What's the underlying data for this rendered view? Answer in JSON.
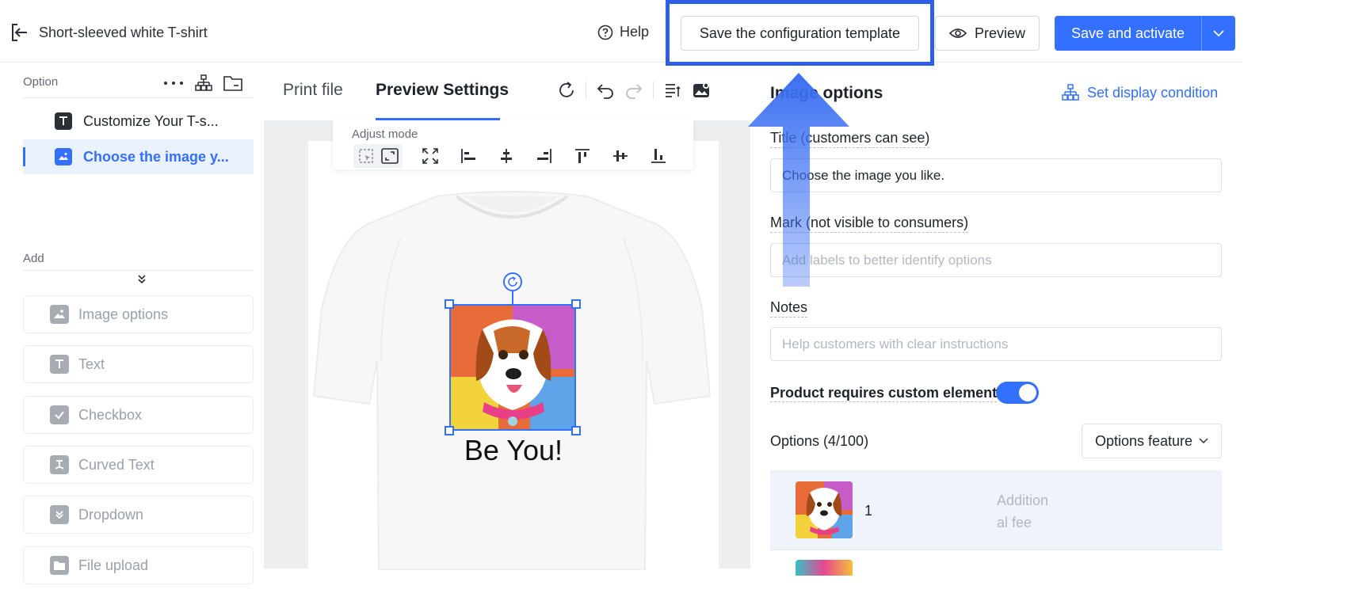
{
  "header": {
    "product_title": "Short-sleeved white T-shirt",
    "help_label": "Help",
    "save_template_label": "Save the configuration template",
    "preview_label": "Preview",
    "save_activate_label": "Save and activate"
  },
  "sidebar": {
    "option_section": "Option",
    "option_items": [
      {
        "label": "Customize Your T-s...",
        "icon": "text-icon"
      },
      {
        "label": "Choose the image y...",
        "icon": "image-icon"
      }
    ],
    "add_section": "Add",
    "add_items": [
      {
        "label": "Image options",
        "icon": "image-icon"
      },
      {
        "label": "Text",
        "icon": "text-icon"
      },
      {
        "label": "Checkbox",
        "icon": "checkbox-icon"
      },
      {
        "label": "Curved Text",
        "icon": "curved-text-icon"
      },
      {
        "label": "Dropdown",
        "icon": "dropdown-icon"
      },
      {
        "label": "File upload",
        "icon": "folder-icon"
      }
    ]
  },
  "canvas": {
    "tabs": [
      {
        "label": "Print file"
      },
      {
        "label": "Preview Settings"
      }
    ],
    "adjust_mode_label": "Adjust mode",
    "print_text": "Be You!"
  },
  "right_panel": {
    "title": "Image options",
    "display_condition": "Set display condition",
    "title_field_label": "Title (customers can see)",
    "title_field_value": "Choose the image you like.",
    "label_field_label": "Mark (not visible to consumers)",
    "label_field_placeholder": "Add labels to better identify options",
    "notes_label": "Notes",
    "notes_placeholder": "Help customers with clear instructions",
    "toggle_label": "Product requires custom element",
    "toggle_on": true,
    "options_count": "Options (4/100)",
    "options_feature": "Options feature",
    "options": [
      {
        "name": "1",
        "fee_line1": "Addition",
        "fee_line2": "al fee"
      }
    ]
  },
  "colors": {
    "accent": "#3370ff",
    "highlight": "#2f5fe8"
  }
}
